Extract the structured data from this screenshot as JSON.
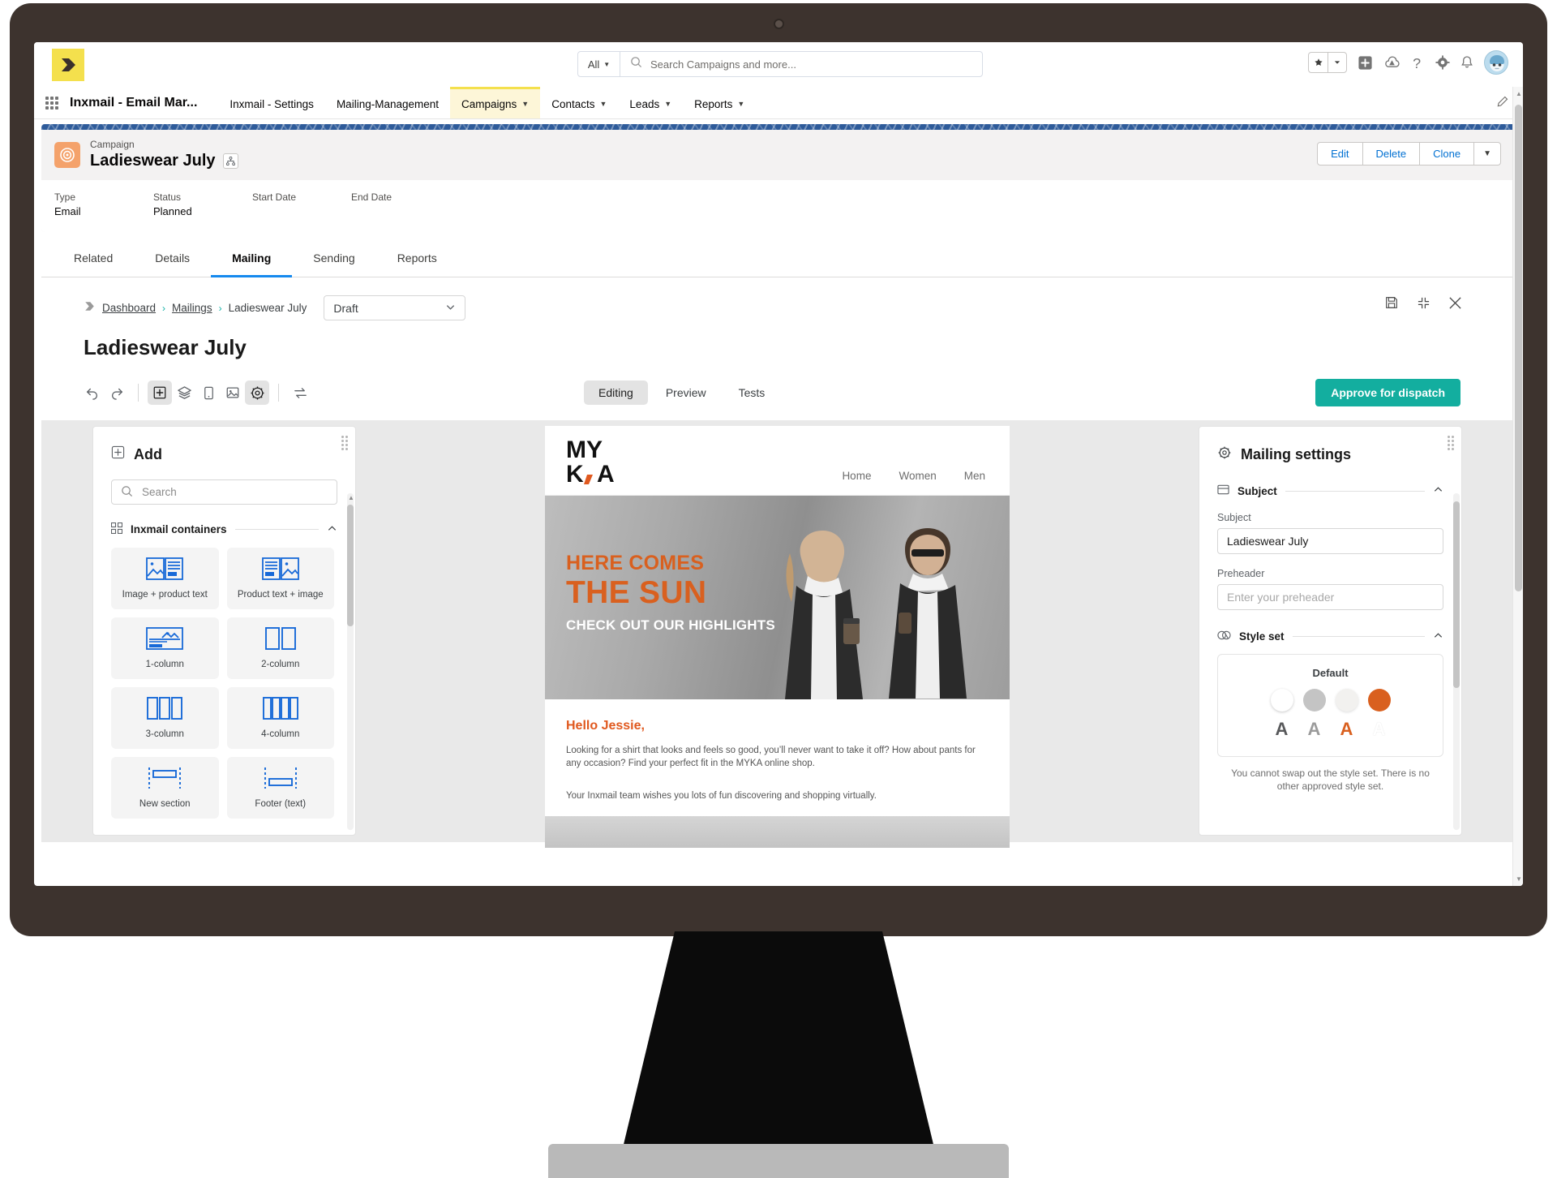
{
  "global_header": {
    "brand_icon": "inxmail-logo-icon",
    "search": {
      "scope": "All",
      "placeholder": "Search Campaigns and more...",
      "icon": "search-icon"
    },
    "actions": [
      {
        "name": "favorites-button",
        "icon": "star-icon"
      },
      {
        "name": "add-button",
        "icon": "plus-square-icon"
      },
      {
        "name": "cloud-setup-button",
        "icon": "cloud-icon"
      },
      {
        "name": "help-button",
        "icon": "question-mark-icon"
      },
      {
        "name": "setup-button",
        "icon": "gear-icon"
      },
      {
        "name": "notifications-button",
        "icon": "bell-icon"
      },
      {
        "name": "user-avatar",
        "icon": "avatar-icon"
      }
    ]
  },
  "app_nav": {
    "waffle_icon": "app-launcher-icon",
    "app_name": "Inxmail - Email Mar...",
    "items": [
      {
        "label": "Inxmail - Settings",
        "has_caret": false,
        "active": false
      },
      {
        "label": "Mailing-Management",
        "has_caret": false,
        "active": false
      },
      {
        "label": "Campaigns",
        "has_caret": true,
        "active": true
      },
      {
        "label": "Contacts",
        "has_caret": true,
        "active": false
      },
      {
        "label": "Leads",
        "has_caret": true,
        "active": false
      },
      {
        "label": "Reports",
        "has_caret": true,
        "active": false
      }
    ],
    "edit_icon": "pencil-icon"
  },
  "record": {
    "icon": "campaign-target-icon",
    "type_label": "Campaign",
    "title": "Ladieswear July",
    "hierarchy_icon": "hierarchy-icon",
    "actions": [
      "Edit",
      "Delete",
      "Clone"
    ],
    "more_icon": "chevron-down-icon",
    "fields": [
      {
        "label": "Type",
        "value": "Email"
      },
      {
        "label": "Status",
        "value": "Planned"
      },
      {
        "label": "Start Date",
        "value": ""
      },
      {
        "label": "End Date",
        "value": ""
      }
    ]
  },
  "record_tabs": [
    {
      "label": "Related",
      "active": false
    },
    {
      "label": "Details",
      "active": false
    },
    {
      "label": "Mailing",
      "active": true
    },
    {
      "label": "Sending",
      "active": false
    },
    {
      "label": "Reports",
      "active": false
    }
  ],
  "editor": {
    "breadcrumb": {
      "logo_icon": "inxmail-mark-icon",
      "items": [
        "Dashboard",
        "Mailings",
        "Ladieswear July"
      ],
      "separator": "›"
    },
    "status_select": {
      "value": "Draft",
      "caret_icon": "chevron-down-icon"
    },
    "head_actions": [
      {
        "name": "save-icon",
        "icon": "save-disk-icon"
      },
      {
        "name": "collapse-icon",
        "icon": "collapse-arrows-icon"
      },
      {
        "name": "close-icon",
        "icon": "x-icon"
      }
    ],
    "mailing_name": "Ladieswear July",
    "toolbar": [
      {
        "name": "undo-button",
        "icon": "undo-arrow-icon",
        "active": false
      },
      {
        "name": "redo-button",
        "icon": "redo-arrow-icon",
        "active": false
      },
      {
        "name": "add-panel-button",
        "icon": "plus-square-icon",
        "active": true
      },
      {
        "name": "layers-button",
        "icon": "layers-icon",
        "active": false
      },
      {
        "name": "mobile-preview-button",
        "icon": "tablet-icon",
        "active": false
      },
      {
        "name": "media-button",
        "icon": "image-icon",
        "active": false
      },
      {
        "name": "settings-button",
        "icon": "gear-icon",
        "active": true
      },
      {
        "name": "swap-button",
        "icon": "swap-arrows-icon",
        "active": false
      }
    ],
    "mode_tabs": [
      {
        "label": "Editing",
        "active": true
      },
      {
        "label": "Preview",
        "active": false
      },
      {
        "label": "Tests",
        "active": false
      }
    ],
    "approve_button": "Approve for dispatch"
  },
  "add_panel": {
    "icon": "plus-square-icon",
    "title": "Add",
    "search_placeholder": "Search",
    "search_icon": "search-icon",
    "section": {
      "icon": "grid-icon",
      "label": "Inxmail containers",
      "collapse_icon": "chevron-up-icon"
    },
    "tiles": [
      {
        "label": "Image + product text",
        "icon": "image-left-text-right-icon"
      },
      {
        "label": "Product text + image",
        "icon": "text-left-image-right-icon"
      },
      {
        "label": "1-column",
        "icon": "one-column-icon"
      },
      {
        "label": "2-column",
        "icon": "two-column-icon"
      },
      {
        "label": "3-column",
        "icon": "three-column-icon"
      },
      {
        "label": "4-column",
        "icon": "four-column-icon"
      },
      {
        "label": "New section",
        "icon": "new-section-icon"
      },
      {
        "label": "Footer (text)",
        "icon": "footer-text-icon"
      }
    ]
  },
  "email_preview": {
    "logo": {
      "line1": "MY",
      "line2": "K",
      "line2b": "A",
      "comma": ","
    },
    "nav": [
      "Home",
      "Women",
      "Men"
    ],
    "hero": {
      "line1": "HERE COMES",
      "line2": "THE SUN",
      "line3": "CHECK OUT OUR HIGHLIGHTS"
    },
    "greeting": "Hello Jessie,",
    "paragraph1": "Looking for a shirt that looks and feels so good, you’ll never want to take it off? How about pants for any occasion? Find your perfect fit in the MYKA online shop.",
    "paragraph2": "Your Inxmail team wishes you lots of fun discovering and shopping virtually."
  },
  "settings_panel": {
    "icon": "gear-icon",
    "title": "Mailing settings",
    "subject_section": {
      "icon": "subject-box-icon",
      "label": "Subject",
      "collapse_icon": "chevron-up-icon",
      "subject_label": "Subject",
      "subject_value": "Ladieswear July",
      "preheader_label": "Preheader",
      "preheader_placeholder": "Enter your preheader"
    },
    "style_section": {
      "icon": "style-set-icon",
      "label": "Style set",
      "collapse_icon": "chevron-up-icon",
      "style_name": "Default",
      "swatches": [
        "#ffffff",
        "#c4c4c4",
        "#f2f1ef",
        "#d9601f"
      ],
      "glyph_colors": [
        "#58595b",
        "#9b9b9b",
        "#d9601f",
        "#ffffff"
      ],
      "glyph_letter": "A",
      "note": "You cannot swap out the style set. There is no other approved style set."
    }
  },
  "colors": {
    "brand_yellow": "#f4e04d",
    "accent_teal": "#13ae9f",
    "accent_orange": "#d9601f",
    "link_blue": "#0070d2",
    "tab_blue": "#1589ee"
  }
}
